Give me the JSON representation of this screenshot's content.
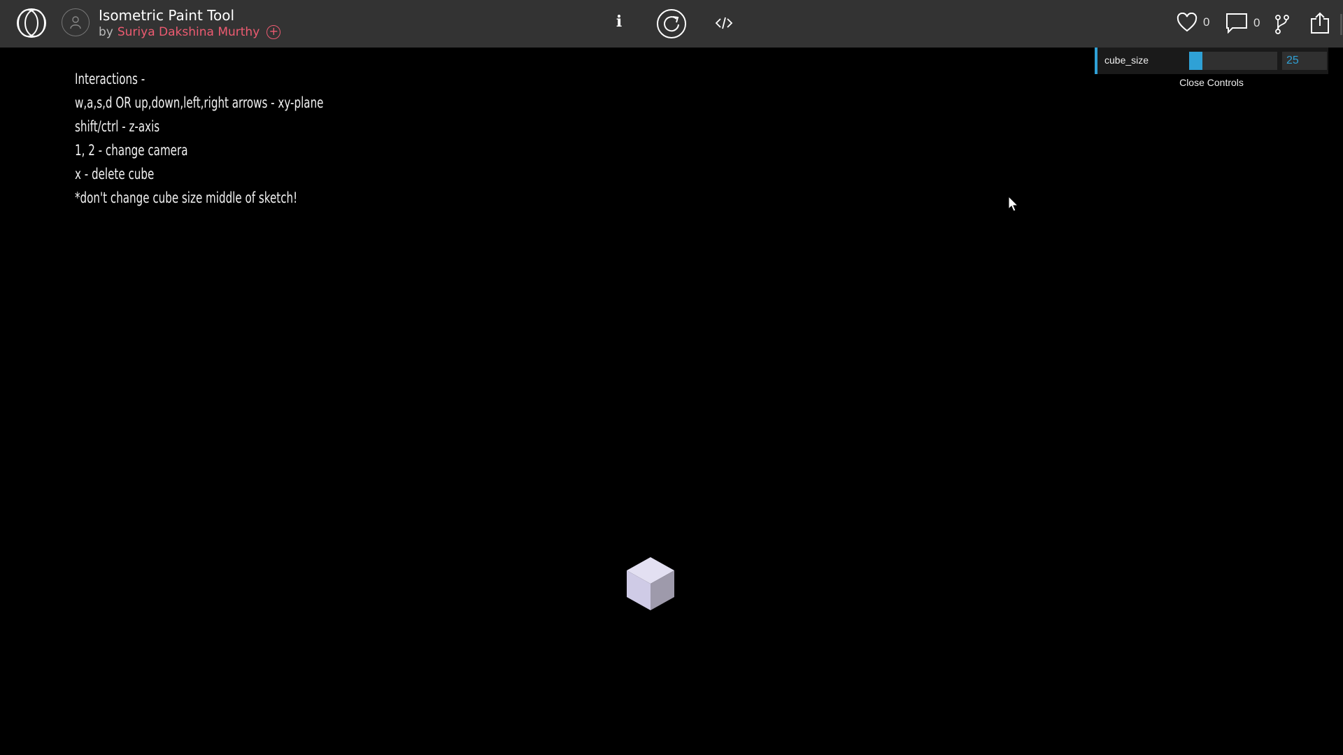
{
  "header": {
    "title": "Isometric Paint Tool",
    "by_prefix": "by",
    "author": "Suriya Dakshina Murthy",
    "follow_icon": "plus-circle-icon",
    "likes_count": "0",
    "comments_count": "0",
    "icons": [
      "logo-icon",
      "avatar-icon",
      "info-icon",
      "reload-icon",
      "code-icon",
      "heart-icon",
      "comment-icon",
      "fork-icon",
      "share-icon"
    ]
  },
  "instructions": [
    "Interactions -",
    "w,a,s,d OR up,down,left,right arrows - xy-plane",
    "shift/ctrl - z-axis",
    "1, 2 - change camera",
    "x - delete cube",
    "*don't change cube size middle of sketch!"
  ],
  "controls": {
    "param_name": "cube_size",
    "value": "25",
    "slider_fraction": 0.15,
    "close_label": "Close Controls"
  },
  "colors": {
    "topbar": "#333333",
    "author": "#ed5b71",
    "accent": "#2fa1d6",
    "cube_top": "#e3e0f2",
    "cube_left": "#cfcbe6",
    "cube_right": "#9e9aab"
  }
}
